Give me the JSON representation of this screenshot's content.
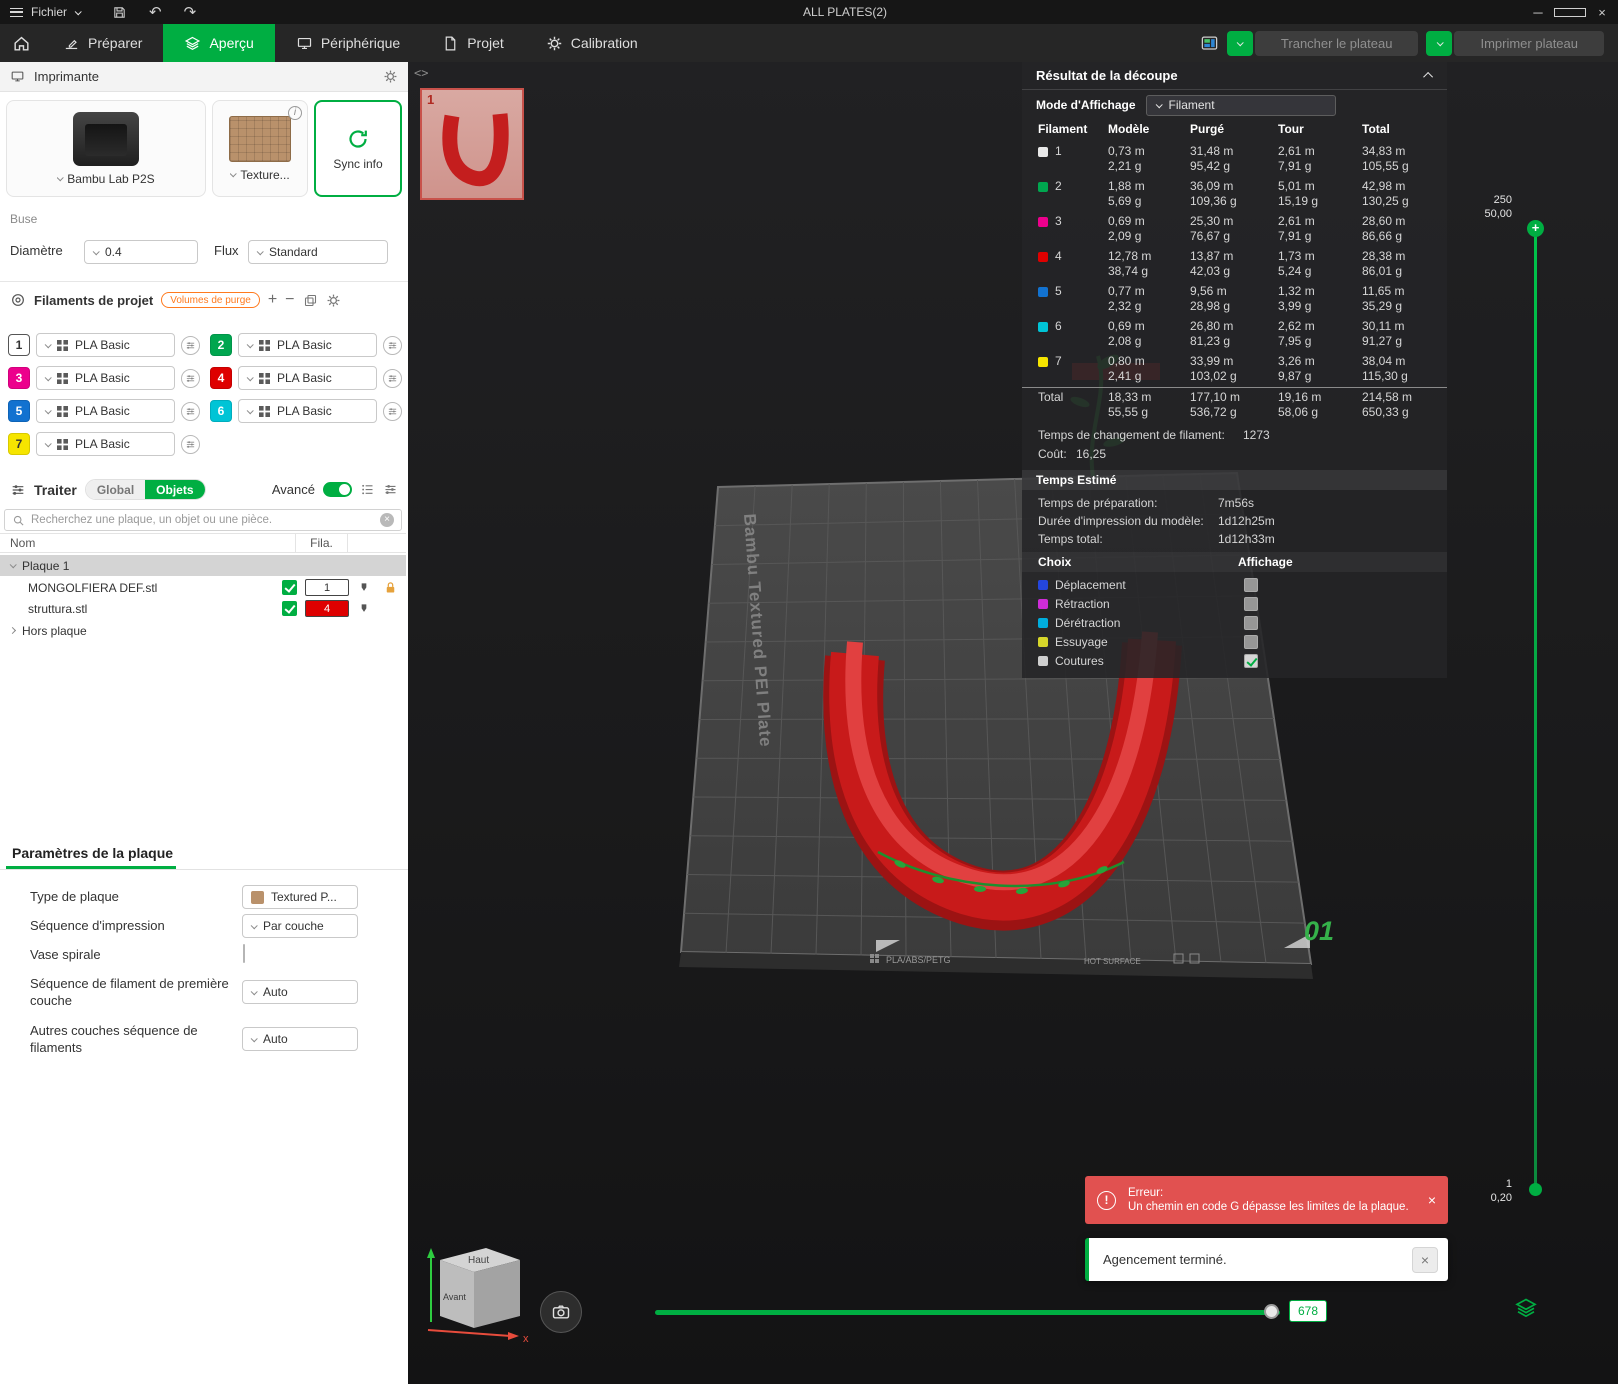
{
  "titlebar": {
    "menu": "Fichier",
    "title": "ALL PLATES(2)"
  },
  "nav": {
    "tabs": [
      {
        "label": "Préparer"
      },
      {
        "label": "Aperçu"
      },
      {
        "label": "Périphérique"
      },
      {
        "label": "Projet"
      },
      {
        "label": "Calibration"
      }
    ],
    "slice_button": "Trancher le plateau",
    "print_button": "Imprimer plateau"
  },
  "printer": {
    "section_title": "Imprimante",
    "name": "Bambu Lab P2S",
    "plate_type": "Texture...",
    "sync_label": "Sync info",
    "nozzle_title": "Buse",
    "diameter_label": "Diamètre",
    "diameter_value": "0.4",
    "flow_label": "Flux",
    "flow_value": "Standard"
  },
  "filaments": {
    "section_title": "Filaments de projet",
    "purge_badge": "Volumes de purge",
    "items": [
      {
        "num": "1",
        "name": "PLA Basic",
        "color": "#FFFFFF",
        "text": "#333333",
        "border": "#555555"
      },
      {
        "num": "2",
        "name": "PLA Basic",
        "color": "#00A64F",
        "text": "#FFFFFF",
        "border": "#00944a"
      },
      {
        "num": "3",
        "name": "PLA Basic",
        "color": "#EC008C",
        "text": "#FFFFFF",
        "border": "#d1007c"
      },
      {
        "num": "4",
        "name": "PLA Basic",
        "color": "#DE0000",
        "text": "#FFFFFF",
        "border": "#c40000"
      },
      {
        "num": "5",
        "name": "PLA Basic",
        "color": "#1272D0",
        "text": "#FFFFFF",
        "border": "#0e63b6"
      },
      {
        "num": "6",
        "name": "PLA Basic",
        "color": "#00C4D6",
        "text": "#FFFFFF",
        "border": "#00adbd"
      },
      {
        "num": "7",
        "name": "PLA Basic",
        "color": "#F6E500",
        "text": "#333333",
        "border": "#d8c900"
      }
    ]
  },
  "process": {
    "section_title": "Traiter",
    "scope_global": "Global",
    "scope_objects": "Objets",
    "advanced_label": "Avancé",
    "search_placeholder": "Recherchez une plaque, un objet ou une pièce.",
    "col_name": "Nom",
    "col_filament": "Fila.",
    "plate_row": "Plaque 1",
    "objects": [
      {
        "name": "MONGOLFIERA DEF.stl",
        "filament": "1",
        "fil_bg": "#FFFFFF",
        "fil_text": "#333333",
        "visible": "true"
      },
      {
        "name": "struttura.stl",
        "filament": "4",
        "fil_bg": "#DE0000",
        "fil_text": "#FFFFFF",
        "visible": "true"
      }
    ],
    "off_plate": "Hors plaque"
  },
  "plate_settings": {
    "section_title": "Paramètres de la plaque",
    "type_label": "Type de plaque",
    "type_value": "Textured P...",
    "sequence_label": "Séquence d'impression",
    "sequence_value": "Par couche",
    "spiral_label": "Vase spirale",
    "spiral_checked": "false",
    "first_layer_label": "Séquence de filament de première couche",
    "first_layer_value": "Auto",
    "other_layers_label": "Autres couches séquence de filaments",
    "other_layers_value": "Auto"
  },
  "slice_result": {
    "title": "Résultat de la découpe",
    "mode_label": "Mode d'Affichage",
    "mode_value": "Filament",
    "columns": [
      "Filament",
      "Modèle",
      "Purgé",
      "Tour",
      "Total"
    ],
    "rows": [
      {
        "num": "1",
        "color": "#E8E8E8",
        "model_m": "0,73 m",
        "model_g": "2,21 g",
        "purge_m": "31,48 m",
        "purge_g": "95,42 g",
        "tower_m": "2,61 m",
        "tower_g": "7,91 g",
        "total_m": "34,83 m",
        "total_g": "105,55 g"
      },
      {
        "num": "2",
        "color": "#00A64F",
        "model_m": "1,88 m",
        "model_g": "5,69 g",
        "purge_m": "36,09 m",
        "purge_g": "109,36 g",
        "tower_m": "5,01 m",
        "tower_g": "15,19 g",
        "total_m": "42,98 m",
        "total_g": "130,25 g"
      },
      {
        "num": "3",
        "color": "#EC008C",
        "model_m": "0,69 m",
        "model_g": "2,09 g",
        "purge_m": "25,30 m",
        "purge_g": "76,67 g",
        "tower_m": "2,61 m",
        "tower_g": "7,91 g",
        "total_m": "28,60 m",
        "total_g": "86,66 g"
      },
      {
        "num": "4",
        "color": "#DE0000",
        "model_m": "12,78 m",
        "model_g": "38,74 g",
        "purge_m": "13,87 m",
        "purge_g": "42,03 g",
        "tower_m": "1,73 m",
        "tower_g": "5,24 g",
        "total_m": "28,38 m",
        "total_g": "86,01 g"
      },
      {
        "num": "5",
        "color": "#1272D0",
        "model_m": "0,77 m",
        "model_g": "2,32 g",
        "purge_m": "9,56 m",
        "purge_g": "28,98 g",
        "tower_m": "1,32 m",
        "tower_g": "3,99 g",
        "total_m": "11,65 m",
        "total_g": "35,29 g"
      },
      {
        "num": "6",
        "color": "#00C4D6",
        "model_m": "0,69 m",
        "model_g": "2,08 g",
        "purge_m": "26,80 m",
        "purge_g": "81,23 g",
        "tower_m": "2,62 m",
        "tower_g": "7,95 g",
        "total_m": "30,11 m",
        "total_g": "91,27 g"
      },
      {
        "num": "7",
        "color": "#F6E500",
        "model_m": "0,80 m",
        "model_g": "2,41 g",
        "purge_m": "33,99 m",
        "purge_g": "103,02 g",
        "tower_m": "3,26 m",
        "tower_g": "9,87 g",
        "total_m": "38,04 m",
        "total_g": "115,30 g"
      }
    ],
    "total": {
      "label": "Total",
      "model_m": "18,33 m",
      "model_g": "55,55 g",
      "purge_m": "177,10 m",
      "purge_g": "536,72 g",
      "tower_m": "19,16 m",
      "tower_g": "58,06 g",
      "total_m": "214,58 m",
      "total_g": "650,33 g"
    },
    "change_label": "Temps de changement de filament:",
    "change_value": "1273",
    "cost_label": "Coût:",
    "cost_value": "16,25",
    "time_title": "Temps Estimé",
    "time_rows": [
      {
        "label": "Temps de préparation:",
        "value": "7m56s"
      },
      {
        "label": "Durée d'impression du modèle:",
        "value": "1d12h25m"
      },
      {
        "label": "Temps total:",
        "value": "1d12h33m"
      }
    ],
    "choice_header": "Choix",
    "display_header": "Affichage",
    "choices": [
      {
        "label": "Déplacement",
        "color": "#2446DE",
        "checked": "false"
      },
      {
        "label": "Rétraction",
        "color": "#CE2CD8",
        "checked": "false"
      },
      {
        "label": "Dérétraction",
        "color": "#00AEDE",
        "checked": "false"
      },
      {
        "label": "Essuyage",
        "color": "#D6D62A",
        "checked": "false"
      },
      {
        "label": "Coutures",
        "color": "#CFCFCF",
        "checked": "true"
      }
    ]
  },
  "viewport": {
    "thumb_number": "1",
    "plate_brand": "Bambu Textured PEI Plate",
    "plate_materials": "PLA/ABS/PETG",
    "plate_surface": "HOT SURFACE",
    "plate_number": "01",
    "axis_top": "Haut",
    "axis_front": "Avant",
    "axis_x": "x",
    "slider_value": "678"
  },
  "layer_slider": {
    "top_layer": "250",
    "top_height": "50,00",
    "bottom_layer": "1",
    "bottom_height": "0,20"
  },
  "toasts": {
    "error_title": "Erreur:",
    "error_message": "Un chemin en code G dépasse les limites de la plaque.",
    "success_message": "Agencement terminé."
  }
}
